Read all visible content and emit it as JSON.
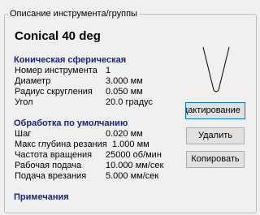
{
  "group": {
    "title": "Описание инструмента/группы"
  },
  "tool": {
    "name": "Conical 40 deg"
  },
  "section_geometry": {
    "title": "Коническая сферическая",
    "rows": [
      {
        "label": "Номер инструмента",
        "value": "1"
      },
      {
        "label": "Диаметр",
        "value": "3.000 мм"
      },
      {
        "label": "Радиус скругления",
        "value": "0.050 мм"
      },
      {
        "label": "Угол",
        "value": "20.0 градус"
      }
    ]
  },
  "section_defaults": {
    "title": "Обработка по умолчанию",
    "rows": [
      {
        "label": "Шаг",
        "value": "0.020 мм"
      },
      {
        "label": "Макс глубина резания",
        "value": "1.000 мм"
      },
      {
        "label": "Частота вращения",
        "value": "25000 об/мин"
      },
      {
        "label": "Рабочая подача",
        "value": "10.000 мм/сек"
      },
      {
        "label": "Подача врезания",
        "value": "5.000 мм/сек"
      }
    ]
  },
  "section_notes": {
    "title": "Примечания"
  },
  "buttons": {
    "edit": "Редактирование",
    "delete": "Удалить",
    "copy": "Копировать"
  },
  "preview": {
    "icon": "conical-tool-icon"
  }
}
